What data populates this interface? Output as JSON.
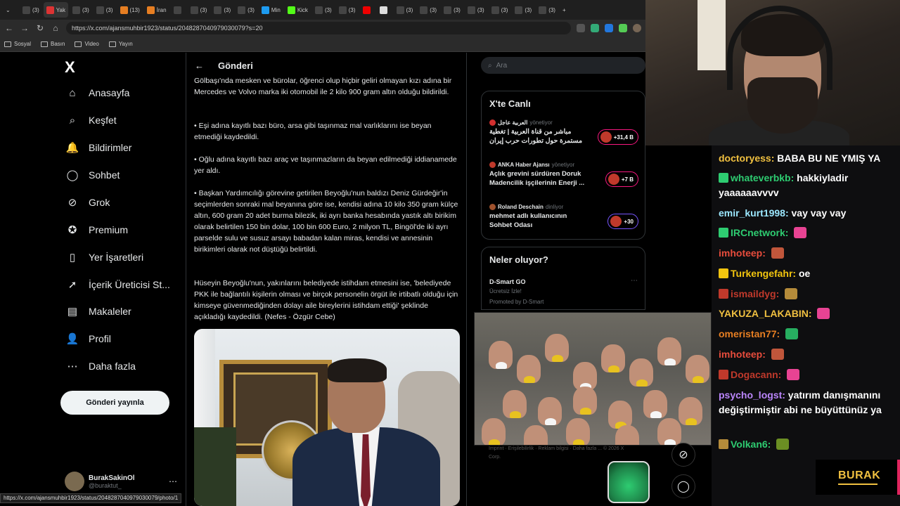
{
  "browser": {
    "tabs": [
      {
        "label": "(3)",
        "color": "#444"
      },
      {
        "label": "Yak",
        "color": "#d33"
      },
      {
        "label": "(3)",
        "color": "#444"
      },
      {
        "label": "(3)",
        "color": "#444"
      },
      {
        "label": "(13)",
        "color": "#e67e22"
      },
      {
        "label": "İran",
        "color": "#e67e22"
      },
      {
        "label": "",
        "color": "#444"
      },
      {
        "label": "(3)",
        "color": "#444"
      },
      {
        "label": "(3)",
        "color": "#444"
      },
      {
        "label": "(3)",
        "color": "#444"
      },
      {
        "label": "Min",
        "color": "#1d9bf0"
      },
      {
        "label": "Kick",
        "color": "#53fc18"
      },
      {
        "label": "(3)",
        "color": "#444"
      },
      {
        "label": "(3)",
        "color": "#444"
      },
      {
        "label": "",
        "color": "#e00"
      },
      {
        "label": "",
        "color": "#ddd"
      },
      {
        "label": "(3)",
        "color": "#444"
      },
      {
        "label": "(3)",
        "color": "#444"
      },
      {
        "label": "(3)",
        "color": "#444"
      },
      {
        "label": "(3)",
        "color": "#444"
      },
      {
        "label": "(3)",
        "color": "#444"
      },
      {
        "label": "(3)",
        "color": "#444"
      },
      {
        "label": "(3)",
        "color": "#444"
      }
    ],
    "url": "https://x.com/ajansmuhbir1923/status/2048287040979030079?s=20",
    "bookmarks": [
      "Sosyal",
      "Basın",
      "Video",
      "Yayın"
    ],
    "status_url": "https://x.com/ajansmuhbir1923/status/2048287040979030079/photo/1"
  },
  "nav": {
    "logo": "X",
    "items": [
      {
        "label": "Anasayfa",
        "icon": "home-icon",
        "glyph": "⌂"
      },
      {
        "label": "Keşfet",
        "icon": "search-icon",
        "glyph": "⌕"
      },
      {
        "label": "Bildirimler",
        "icon": "bell-icon",
        "glyph": "🔔"
      },
      {
        "label": "Sohbet",
        "icon": "chat-icon",
        "glyph": "◯"
      },
      {
        "label": "Grok",
        "icon": "grok-icon",
        "glyph": "⊘"
      },
      {
        "label": "Premium",
        "icon": "premium-icon",
        "glyph": "✪"
      },
      {
        "label": "Yer İşaretleri",
        "icon": "bookmark-icon",
        "glyph": "▯"
      },
      {
        "label": "İçerik Üreticisi St...",
        "icon": "rocket-icon",
        "glyph": "➚"
      },
      {
        "label": "Makaleler",
        "icon": "article-icon",
        "glyph": "▤"
      },
      {
        "label": "Profil",
        "icon": "profile-icon",
        "glyph": "👤"
      },
      {
        "label": "Daha fazla",
        "icon": "more-icon",
        "glyph": "⋯"
      }
    ],
    "post_button": "Gönderi yayınla",
    "account": {
      "name": "BurakSakinOl",
      "handle": "@buraktut_"
    }
  },
  "post": {
    "header": "Gönderi",
    "paragraphs": [
      "Gölbaşı'nda mesken ve bürolar, öğrenci olup hiçbir geliri olmayan kızı adına bir Mercedes ve Volvo marka iki otomobil ile 2 kilo 900 gram altın olduğu bildirildi.",
      "• Eşi adına kayıtlı bazı büro, arsa gibi taşınmaz mal varlıklarını ise beyan etmediği kaydedildi.",
      "• Oğlu adına kayıtlı bazı araç ve taşınmazların da beyan edilmediği iddianamede yer aldı.",
      "• Başkan Yardımcılığı görevine getirilen Beyoğlu'nun baldızı Deniz Gürdeğir'in seçimlerden sonraki mal beyanına göre ise, kendisi adına 10 kilo 350 gram külçe altın, 600 gram 20 adet burma bilezik, iki ayrı banka hesabında yastık altı birikim olarak belirtilen 150 bin dolar, 100 bin 600 Euro, 2 milyon TL, Bingöl'de iki ayrı parselde sulu ve susuz arsayı babadan kalan miras, kendisi ve annesinin birikimleri olarak not düştüğü belirtildi.",
      "Hüseyin Beyoğlu'nun, yakınlarını belediyede istihdam etmesini ise, 'belediyede PKK ile bağlantılı kişilerin olması ve birçok personelin örgüt ile irtibatlı olduğu için kimseye güvenmediğinden dolayı aile bireylerini istihdam ettiği' şeklinde açıkladığı kaydedildi. (Nefes - Özgür Cebe)"
    ]
  },
  "sidebar": {
    "search_placeholder": "Ara",
    "live_title": "X'te Canlı",
    "live_items": [
      {
        "source": "العربية عاجل",
        "role": "yönetiyor",
        "title": "مباشر من قناة العربية | تغطية مستمرة حول تطورات حرب إيران",
        "count": "+31,4 B",
        "dot": "#d32f2f",
        "badge_style": ""
      },
      {
        "source": "ANKA Haber Ajansı",
        "role": "yönetiyor",
        "title": "Açlık grevini sürdüren Doruk Madencilik işçilerinin Enerji ...",
        "count": "+7 B",
        "dot": "#c0392b",
        "badge_style": ""
      },
      {
        "source": "Roland Deschain",
        "role": "dinliyor",
        "title": "mehmet adlı kullanıcının Sohbet Odası",
        "count": "+30",
        "dot": "#a0522d",
        "badge_style": "blue"
      }
    ],
    "trends_title": "Neler oluyor?",
    "ad": {
      "name": "D-Smart GO",
      "sub": "Ücretsiz İzle!",
      "promo": "Promoted by D-Smart"
    },
    "footer": "Imprint · Erişilebilirlik · Reklam bilgisi · Daha fazla ... © 2026 X Corp."
  },
  "chat": {
    "messages": [
      {
        "user": "doctoryess:",
        "text": "BABA BU NE YMIŞ YA",
        "color": "#f0c040",
        "badge": "",
        "emote": ""
      },
      {
        "user": "whateverbkb:",
        "text": "hakkiyladir yaaaaaavvvv",
        "color": "#2ecc71",
        "badge": "#2ecc71",
        "emote": ""
      },
      {
        "user": "emir_kurt1998:",
        "text": "vay vay vay",
        "color": "#9be7ff",
        "badge": "",
        "emote": ""
      },
      {
        "user": "IRCnetwork:",
        "text": "",
        "color": "#2ecc71",
        "badge": "#2ecc71",
        "emote": "#e84393"
      },
      {
        "user": "imhoteep:",
        "text": "",
        "color": "#e74c3c",
        "badge": "",
        "emote": "#c0563b"
      },
      {
        "user": "Turkengefahr:",
        "text": "oe",
        "color": "#f1c40f",
        "badge": "#f1c40f",
        "emote": ""
      },
      {
        "user": "ismaildyg:",
        "text": "",
        "color": "#c0392b",
        "badge": "#c0392b",
        "emote": "#b58b3a"
      },
      {
        "user": "YAKUZA_LAKABIN:",
        "text": "",
        "color": "#f0c040",
        "badge": "",
        "emote": "#e84393"
      },
      {
        "user": "omeristan77:",
        "text": "",
        "color": "#e67e22",
        "badge": "",
        "emote": "#27ae60"
      },
      {
        "user": "imhoteep:",
        "text": "",
        "color": "#e74c3c",
        "badge": "",
        "emote": "#c0563b"
      },
      {
        "user": "Dogacann:",
        "text": "",
        "color": "#c0392b",
        "badge": "#c0392b",
        "emote": "#e84393"
      },
      {
        "user": "psycho_logst:",
        "text": "yatırım danışmanını değiştirmiştir abi ne büyüttünüz ya",
        "color": "#bb86fc",
        "badge": "",
        "emote": ""
      },
      {
        "user": "Volkan6:",
        "text": "",
        "color": "#2ecc71",
        "badge": "#b58b3a",
        "emote": "#6b8e23"
      }
    ]
  },
  "brand": {
    "name": "BURAK"
  }
}
